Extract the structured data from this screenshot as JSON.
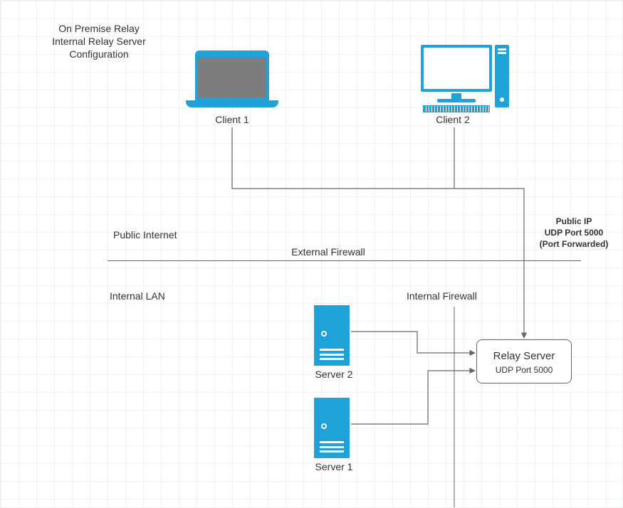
{
  "title": "On Premise Relay\nInternal Relay Server\nConfiguration",
  "clients": {
    "client1": "Client 1",
    "client2": "Client 2"
  },
  "zones": {
    "publicInternet": "Public Internet",
    "externalFirewall": "External Firewall",
    "internalLan": "Internal LAN",
    "internalFirewall": "Internal Firewall"
  },
  "publicIpNote": "Public IP\nUDP Port 5000\n(Port Forwarded)",
  "servers": {
    "server1": "Server 1",
    "server2": "Server 2"
  },
  "relay": {
    "title": "Relay Server",
    "subtitle": "UDP Port 5000"
  },
  "colors": {
    "accent": "#1ea2d8",
    "line": "#666666"
  }
}
